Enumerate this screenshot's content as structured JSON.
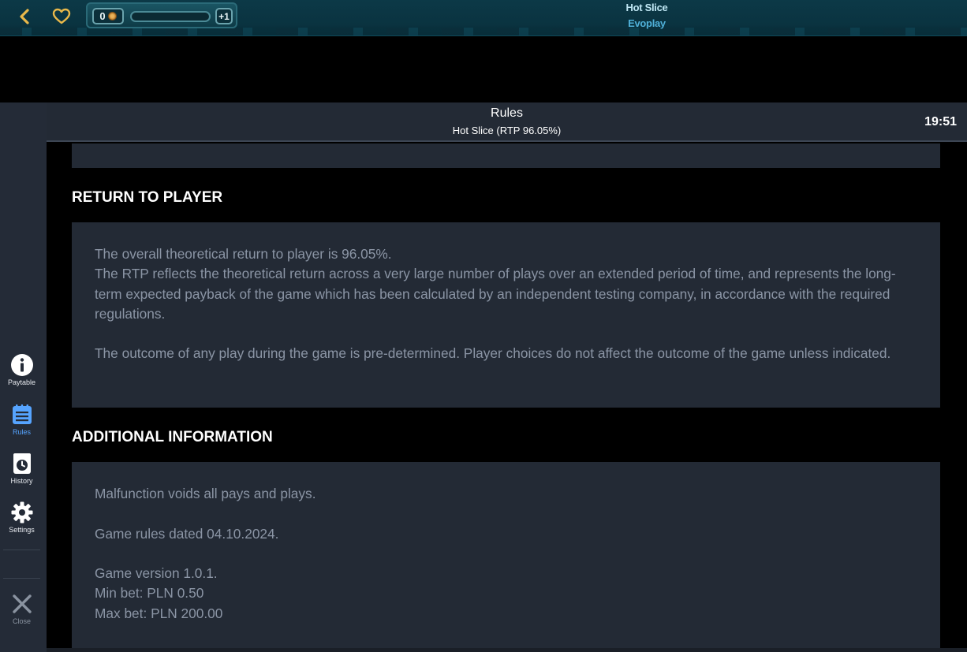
{
  "topbar": {
    "coin_count": "0",
    "plus_label": "+1",
    "game_title": "Hot Slice",
    "game_provider": "Evoplay"
  },
  "sidebar": {
    "items": [
      {
        "label": "Paytable",
        "icon": "info-icon"
      },
      {
        "label": "Rules",
        "icon": "rules-icon",
        "active": true
      },
      {
        "label": "History",
        "icon": "history-icon"
      },
      {
        "label": "Settings",
        "icon": "gear-icon"
      }
    ],
    "close_label": "Close"
  },
  "header": {
    "title": "Rules",
    "subtitle": "Hot Slice (RTP 96.05%)",
    "time": "19:51"
  },
  "sections": {
    "rtp": {
      "heading": "RETURN TO PLAYER",
      "p1_line1": "The overall theoretical return to player is 96.05%.",
      "p1_line2": "The RTP reflects the theoretical return across a very large number of plays over an extended period of time, and represents the long-term expected payback of the game which has been calculated by an independent testing company, in accordance with the required regulations.",
      "p2": "The outcome of any play during the game is pre-determined. Player choices do not affect the outcome of the game unless indicated."
    },
    "info": {
      "heading": "ADDITIONAL INFORMATION",
      "malfunction": "Malfunction voids all pays and plays.",
      "rules_date": "Game rules dated 04.10.2024.",
      "version": "Game version 1.0.1.",
      "min_bet": "Min bet: PLN 0.50",
      "max_bet": "Max bet: PLN 200.00"
    }
  },
  "colors": {
    "accent": "#56a4ff",
    "heart": "#e8b84a",
    "panel": "#232a35",
    "text_muted": "#8b95a5"
  }
}
